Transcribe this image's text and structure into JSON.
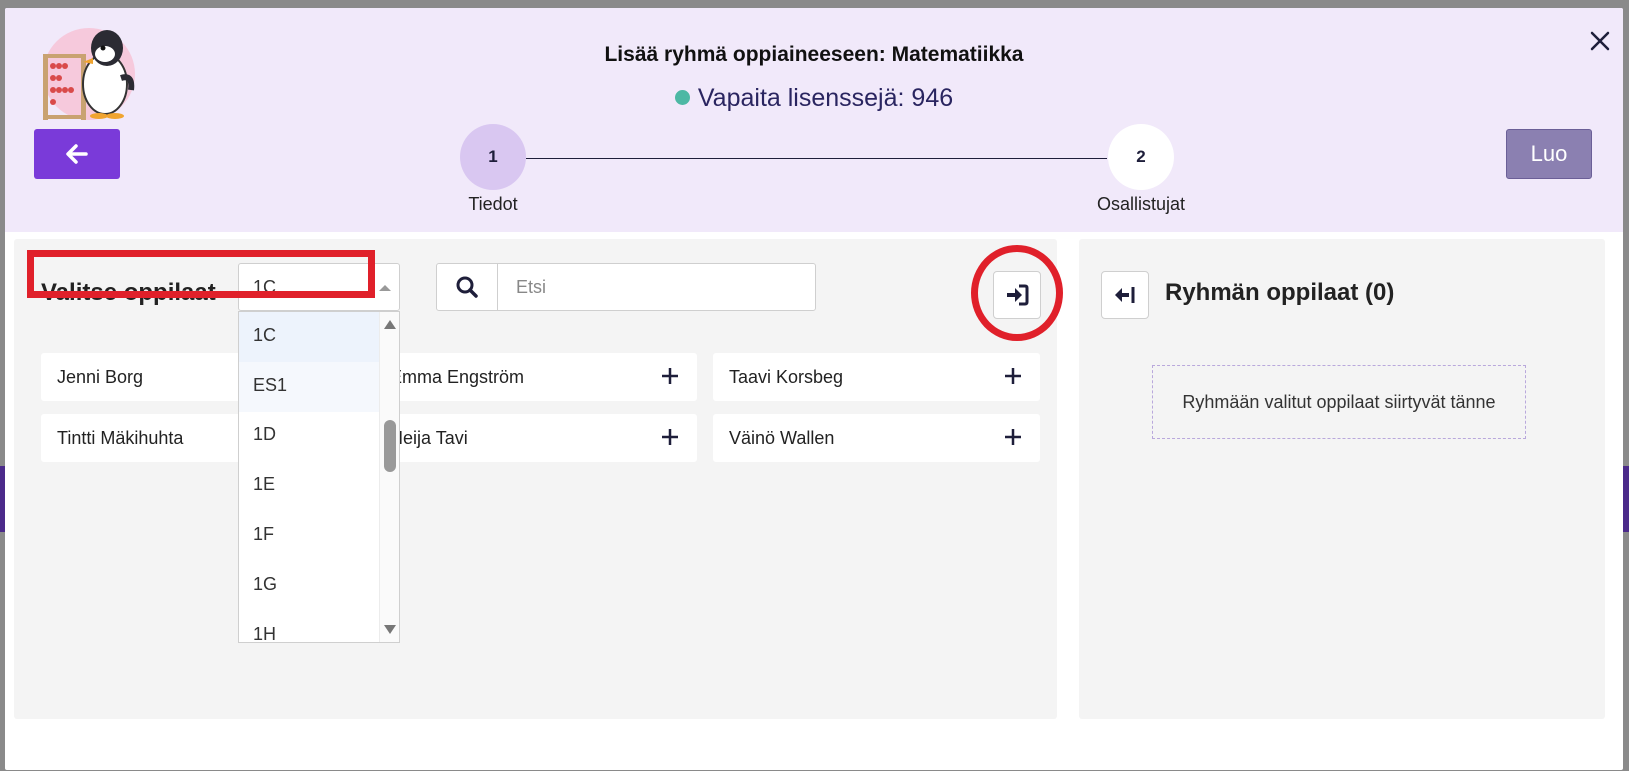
{
  "modal": {
    "title": "Lisää ryhmä oppiaineeseen: Matematiikka",
    "licenses_label": "Vapaita lisenssejä: 946",
    "create_label": "Luo",
    "close_icon": "close-icon",
    "back_icon": "arrow-left-icon"
  },
  "steps": [
    {
      "number": "1",
      "label": "Tiedot"
    },
    {
      "number": "2",
      "label": "Osallistujat"
    }
  ],
  "left_panel": {
    "title": "Valitse oppilaat",
    "class_select": {
      "value": "1C",
      "options": [
        "1C",
        "ES1",
        "1D",
        "1E",
        "1F",
        "1G",
        "1H"
      ]
    },
    "search": {
      "placeholder": "Etsi",
      "value": ""
    },
    "students": [
      {
        "name": "Jenni Borg"
      },
      {
        "name": "Emma Engström"
      },
      {
        "name": "Taavi Korsbeg"
      },
      {
        "name": "Tintti Mäkihuhta"
      },
      {
        "name": "Heija Tavi"
      },
      {
        "name": "Väinö Wallen"
      }
    ]
  },
  "right_panel": {
    "title": "Ryhmän oppilaat (0)",
    "empty_text": "Ryhmään valitut oppilaat siirtyvät tänne"
  },
  "colors": {
    "header_bg": "#f1e9fa",
    "primary": "#7a3ad9",
    "create_button": "#8b80b1",
    "license_dot": "#4db8a4",
    "annotation_red": "#e0202a"
  }
}
